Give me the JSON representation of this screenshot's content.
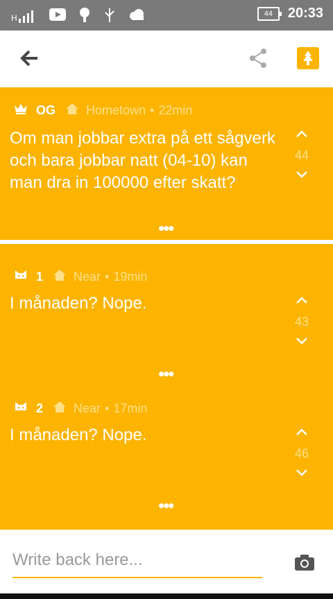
{
  "status_bar": {
    "time": "20:33",
    "battery": "44",
    "signal_label": "H"
  },
  "op": {
    "name": "OG",
    "location": "Hometown",
    "time": "22min",
    "text": "Om man jobbar extra på ett sågverk och bara jobbar natt (04-10) kan man dra in 100000 efter skatt?",
    "votes": "44"
  },
  "replies": [
    {
      "name": "1",
      "location": "Near",
      "time": "19min",
      "text": "I månaden? Nope.",
      "votes": "43"
    },
    {
      "name": "2",
      "location": "Near",
      "time": "17min",
      "text": "I månaden? Nope.",
      "votes": "46"
    }
  ],
  "composer": {
    "placeholder": "Write back here..."
  },
  "colors": {
    "accent": "#fcb400",
    "status_bar": "#7a7a7a",
    "muted_text": "#ffe08a"
  }
}
